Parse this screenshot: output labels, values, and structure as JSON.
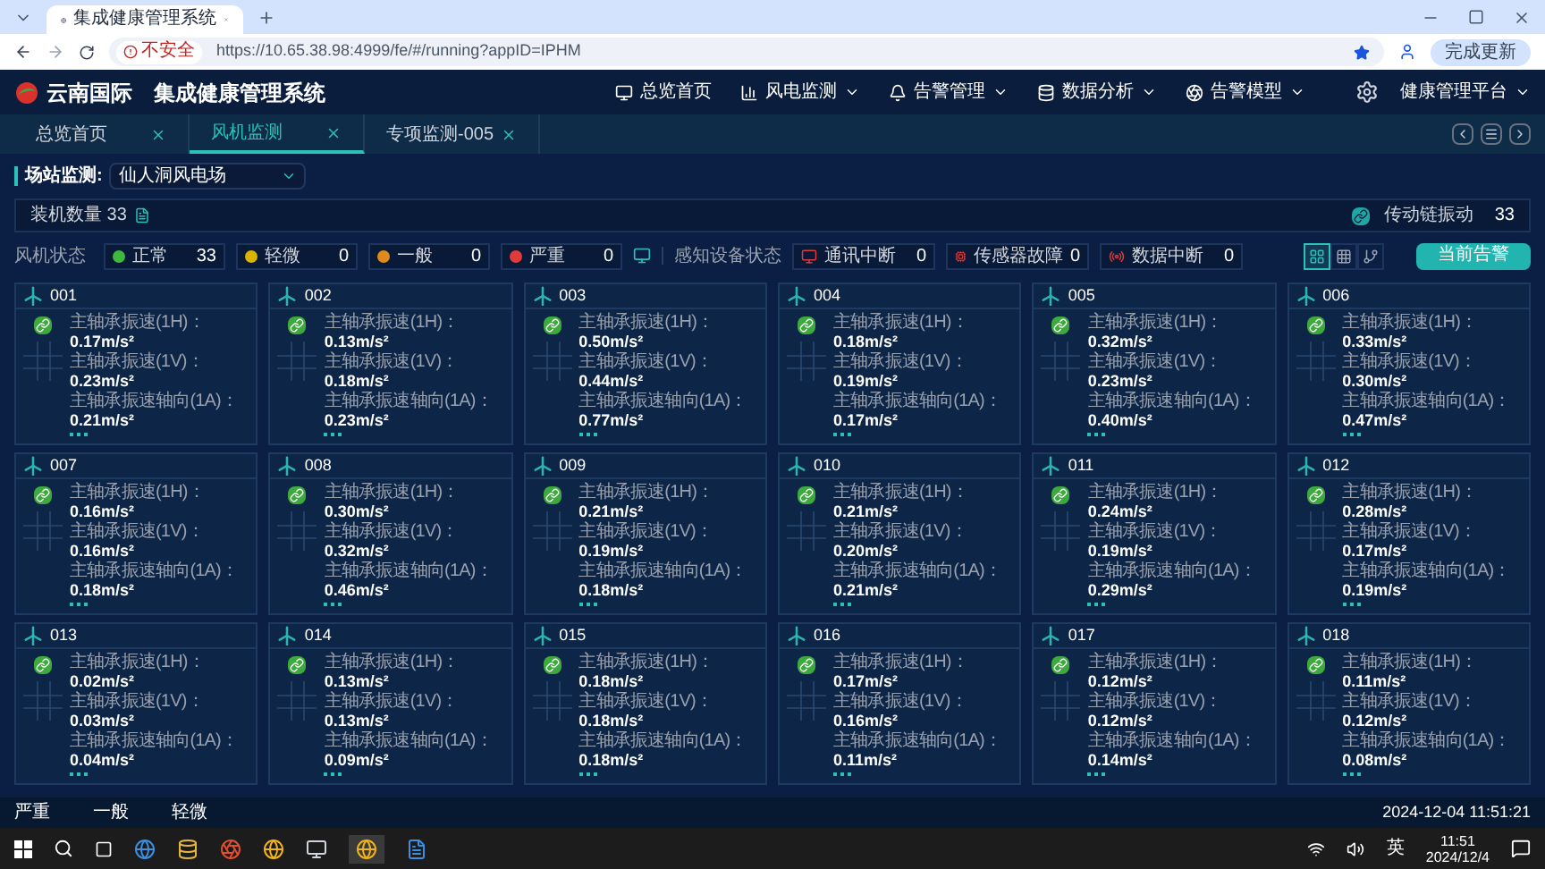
{
  "browser": {
    "tab_title": "集成健康管理系统",
    "security_label": "不安全",
    "url": "https://10.65.38.98:4999/fe/#/running?appID=IPHM",
    "update_button": "完成更新"
  },
  "header": {
    "logo_text": "云南国际",
    "title": "集成健康管理系统",
    "nav": [
      {
        "label": "总览首页",
        "kind": "monitor",
        "has_menu": false
      },
      {
        "label": "风电监测",
        "kind": "chart",
        "has_menu": true
      },
      {
        "label": "告警管理",
        "kind": "alarm",
        "has_menu": true
      },
      {
        "label": "数据分析",
        "kind": "data",
        "has_menu": true
      },
      {
        "label": "告警模型",
        "kind": "model",
        "has_menu": true
      }
    ],
    "platform": "健康管理平台"
  },
  "tabs": [
    {
      "label": "总览首页",
      "selected": false
    },
    {
      "label": "风机监测",
      "selected": true
    },
    {
      "label": "专项监测-005",
      "selected": false
    }
  ],
  "site": {
    "label": "场站监测:",
    "value": "仙人洞风电场"
  },
  "summary": {
    "installed_label": "装机数量",
    "installed_count": "33",
    "vibration_label": "传动链振动",
    "vibration_count": "33"
  },
  "fan_status": {
    "label": "风机状态",
    "items": [
      {
        "label": "正常",
        "count": "33",
        "color": "#3fb83f"
      },
      {
        "label": "轻微",
        "count": "0",
        "color": "#d9b400"
      },
      {
        "label": "一般",
        "count": "0",
        "color": "#e08a1e"
      },
      {
        "label": "严重",
        "count": "0",
        "color": "#e03a3a"
      }
    ]
  },
  "device_status": {
    "label": "感知设备状态",
    "items": [
      {
        "label": "通讯中断",
        "count": "0",
        "kind": "comm"
      },
      {
        "label": "传感器故障",
        "count": "0",
        "kind": "sensor"
      },
      {
        "label": "数据中断",
        "count": "0",
        "kind": "data"
      }
    ]
  },
  "view_modes": [
    {
      "kind": "cards",
      "selected": true
    },
    {
      "kind": "table",
      "selected": false
    },
    {
      "kind": "tree",
      "selected": false
    }
  ],
  "alarm_button": "当前告警",
  "turbines": [
    {
      "name": "001",
      "metrics": [
        {
          "label": "主轴承振速(1H)：",
          "value": "0.17m/s²"
        },
        {
          "label": "主轴承振速(1V)：",
          "value": "0.23m/s²"
        },
        {
          "label": "主轴承振速轴向(1A)：",
          "value": "0.21m/s²"
        }
      ]
    },
    {
      "name": "002",
      "metrics": [
        {
          "label": "主轴承振速(1H)：",
          "value": "0.13m/s²"
        },
        {
          "label": "主轴承振速(1V)：",
          "value": "0.18m/s²"
        },
        {
          "label": "主轴承振速轴向(1A)：",
          "value": "0.23m/s²"
        }
      ]
    },
    {
      "name": "003",
      "metrics": [
        {
          "label": "主轴承振速(1H)：",
          "value": "0.50m/s²"
        },
        {
          "label": "主轴承振速(1V)：",
          "value": "0.44m/s²"
        },
        {
          "label": "主轴承振速轴向(1A)：",
          "value": "0.77m/s²"
        }
      ]
    },
    {
      "name": "004",
      "metrics": [
        {
          "label": "主轴承振速(1H)：",
          "value": "0.18m/s²"
        },
        {
          "label": "主轴承振速(1V)：",
          "value": "0.19m/s²"
        },
        {
          "label": "主轴承振速轴向(1A)：",
          "value": "0.17m/s²"
        }
      ]
    },
    {
      "name": "005",
      "metrics": [
        {
          "label": "主轴承振速(1H)：",
          "value": "0.32m/s²"
        },
        {
          "label": "主轴承振速(1V)：",
          "value": "0.23m/s²"
        },
        {
          "label": "主轴承振速轴向(1A)：",
          "value": "0.40m/s²"
        }
      ]
    },
    {
      "name": "006",
      "metrics": [
        {
          "label": "主轴承振速(1H)：",
          "value": "0.33m/s²"
        },
        {
          "label": "主轴承振速(1V)：",
          "value": "0.30m/s²"
        },
        {
          "label": "主轴承振速轴向(1A)：",
          "value": "0.47m/s²"
        }
      ]
    },
    {
      "name": "007",
      "metrics": [
        {
          "label": "主轴承振速(1H)：",
          "value": "0.16m/s²"
        },
        {
          "label": "主轴承振速(1V)：",
          "value": "0.16m/s²"
        },
        {
          "label": "主轴承振速轴向(1A)：",
          "value": "0.18m/s²"
        }
      ]
    },
    {
      "name": "008",
      "metrics": [
        {
          "label": "主轴承振速(1H)：",
          "value": "0.30m/s²"
        },
        {
          "label": "主轴承振速(1V)：",
          "value": "0.32m/s²"
        },
        {
          "label": "主轴承振速轴向(1A)：",
          "value": "0.46m/s²"
        }
      ]
    },
    {
      "name": "009",
      "metrics": [
        {
          "label": "主轴承振速(1H)：",
          "value": "0.21m/s²"
        },
        {
          "label": "主轴承振速(1V)：",
          "value": "0.19m/s²"
        },
        {
          "label": "主轴承振速轴向(1A)：",
          "value": "0.18m/s²"
        }
      ]
    },
    {
      "name": "010",
      "metrics": [
        {
          "label": "主轴承振速(1H)：",
          "value": "0.21m/s²"
        },
        {
          "label": "主轴承振速(1V)：",
          "value": "0.20m/s²"
        },
        {
          "label": "主轴承振速轴向(1A)：",
          "value": "0.21m/s²"
        }
      ]
    },
    {
      "name": "011",
      "metrics": [
        {
          "label": "主轴承振速(1H)：",
          "value": "0.24m/s²"
        },
        {
          "label": "主轴承振速(1V)：",
          "value": "0.19m/s²"
        },
        {
          "label": "主轴承振速轴向(1A)：",
          "value": "0.29m/s²"
        }
      ]
    },
    {
      "name": "012",
      "metrics": [
        {
          "label": "主轴承振速(1H)：",
          "value": "0.28m/s²"
        },
        {
          "label": "主轴承振速(1V)：",
          "value": "0.17m/s²"
        },
        {
          "label": "主轴承振速轴向(1A)：",
          "value": "0.19m/s²"
        }
      ]
    },
    {
      "name": "013",
      "metrics": [
        {
          "label": "主轴承振速(1H)：",
          "value": "0.02m/s²"
        },
        {
          "label": "主轴承振速(1V)：",
          "value": "0.03m/s²"
        },
        {
          "label": "主轴承振速轴向(1A)：",
          "value": "0.04m/s²"
        }
      ]
    },
    {
      "name": "014",
      "metrics": [
        {
          "label": "主轴承振速(1H)：",
          "value": "0.13m/s²"
        },
        {
          "label": "主轴承振速(1V)：",
          "value": "0.13m/s²"
        },
        {
          "label": "主轴承振速轴向(1A)：",
          "value": "0.09m/s²"
        }
      ]
    },
    {
      "name": "015",
      "metrics": [
        {
          "label": "主轴承振速(1H)：",
          "value": "0.18m/s²"
        },
        {
          "label": "主轴承振速(1V)：",
          "value": "0.18m/s²"
        },
        {
          "label": "主轴承振速轴向(1A)：",
          "value": "0.18m/s²"
        }
      ]
    },
    {
      "name": "016",
      "metrics": [
        {
          "label": "主轴承振速(1H)：",
          "value": "0.17m/s²"
        },
        {
          "label": "主轴承振速(1V)：",
          "value": "0.16m/s²"
        },
        {
          "label": "主轴承振速轴向(1A)：",
          "value": "0.11m/s²"
        }
      ]
    },
    {
      "name": "017",
      "metrics": [
        {
          "label": "主轴承振速(1H)：",
          "value": "0.12m/s²"
        },
        {
          "label": "主轴承振速(1V)：",
          "value": "0.12m/s²"
        },
        {
          "label": "主轴承振速轴向(1A)：",
          "value": "0.14m/s²"
        }
      ]
    },
    {
      "name": "018",
      "metrics": [
        {
          "label": "主轴承振速(1H)：",
          "value": "0.11m/s²"
        },
        {
          "label": "主轴承振速(1V)：",
          "value": "0.12m/s²"
        },
        {
          "label": "主轴承振速轴向(1A)：",
          "value": "0.08m/s²"
        }
      ]
    }
  ],
  "legend": [
    "严重",
    "一般",
    "轻微"
  ],
  "timestamp": "2024-12-04 11:51:21",
  "taskbar": {
    "language": "英",
    "time": "11:51",
    "date": "2024/12/4"
  }
}
